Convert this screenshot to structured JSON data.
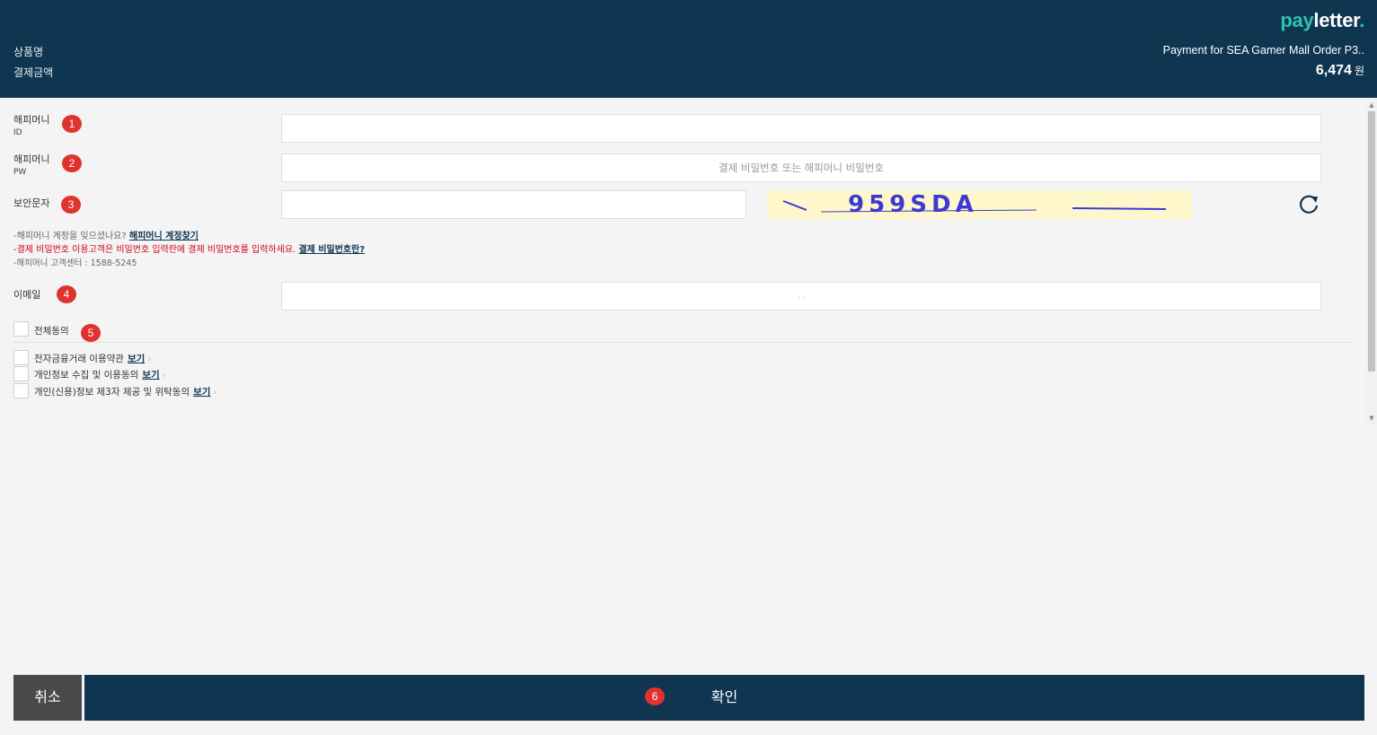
{
  "header": {
    "logo_pay": "pay",
    "logo_letter": "letter",
    "logo_dot": ".",
    "product_label": "상품명",
    "amount_label": "결제금액",
    "product_name": "Payment for SEA Gamer Mall Order P3..",
    "amount_value": "6,474",
    "amount_unit": "원"
  },
  "form": {
    "id_label": "해피머니",
    "id_sub": "ID",
    "pw_label": "해피머니",
    "pw_sub": "PW",
    "pw_placeholder": "결제 비밀번호 또는 해피머니 비밀번호",
    "captcha_label": "보안문자",
    "captcha_text": "959SDA",
    "email_label": "이메일",
    "email_value": ". ."
  },
  "notes": {
    "line1_text": "-해피머니 계정을 잊으셨나요?",
    "line1_link": "해피머니 계정찾기",
    "line2_text": "-결제 비밀번호 이용고객은 비밀번호 입력란에 결제 비밀번호를 입력하세요.",
    "line2_link": "결제 비밀번호란?",
    "line3_text": "-해피머니 고객센터 : 1588-5245"
  },
  "agreements": {
    "all_label": "전체동의",
    "items": [
      {
        "label": "전자금융거래 이용약관",
        "link": "보기"
      },
      {
        "label": "개인정보 수집 및 이용동의",
        "link": "보기"
      },
      {
        "label": "개인(신용)정보 제3자 제공 및 위탁동의",
        "link": "보기"
      }
    ]
  },
  "badges": [
    "1",
    "2",
    "3",
    "4",
    "5",
    "6"
  ],
  "buttons": {
    "cancel": "취소",
    "confirm": "확인"
  },
  "colors": {
    "header_bg": "#0f3551",
    "accent": "#2fc2b3",
    "badge": "#e0332f",
    "warning_text": "#d0021b",
    "cancel_bg": "#4a4a4a"
  }
}
